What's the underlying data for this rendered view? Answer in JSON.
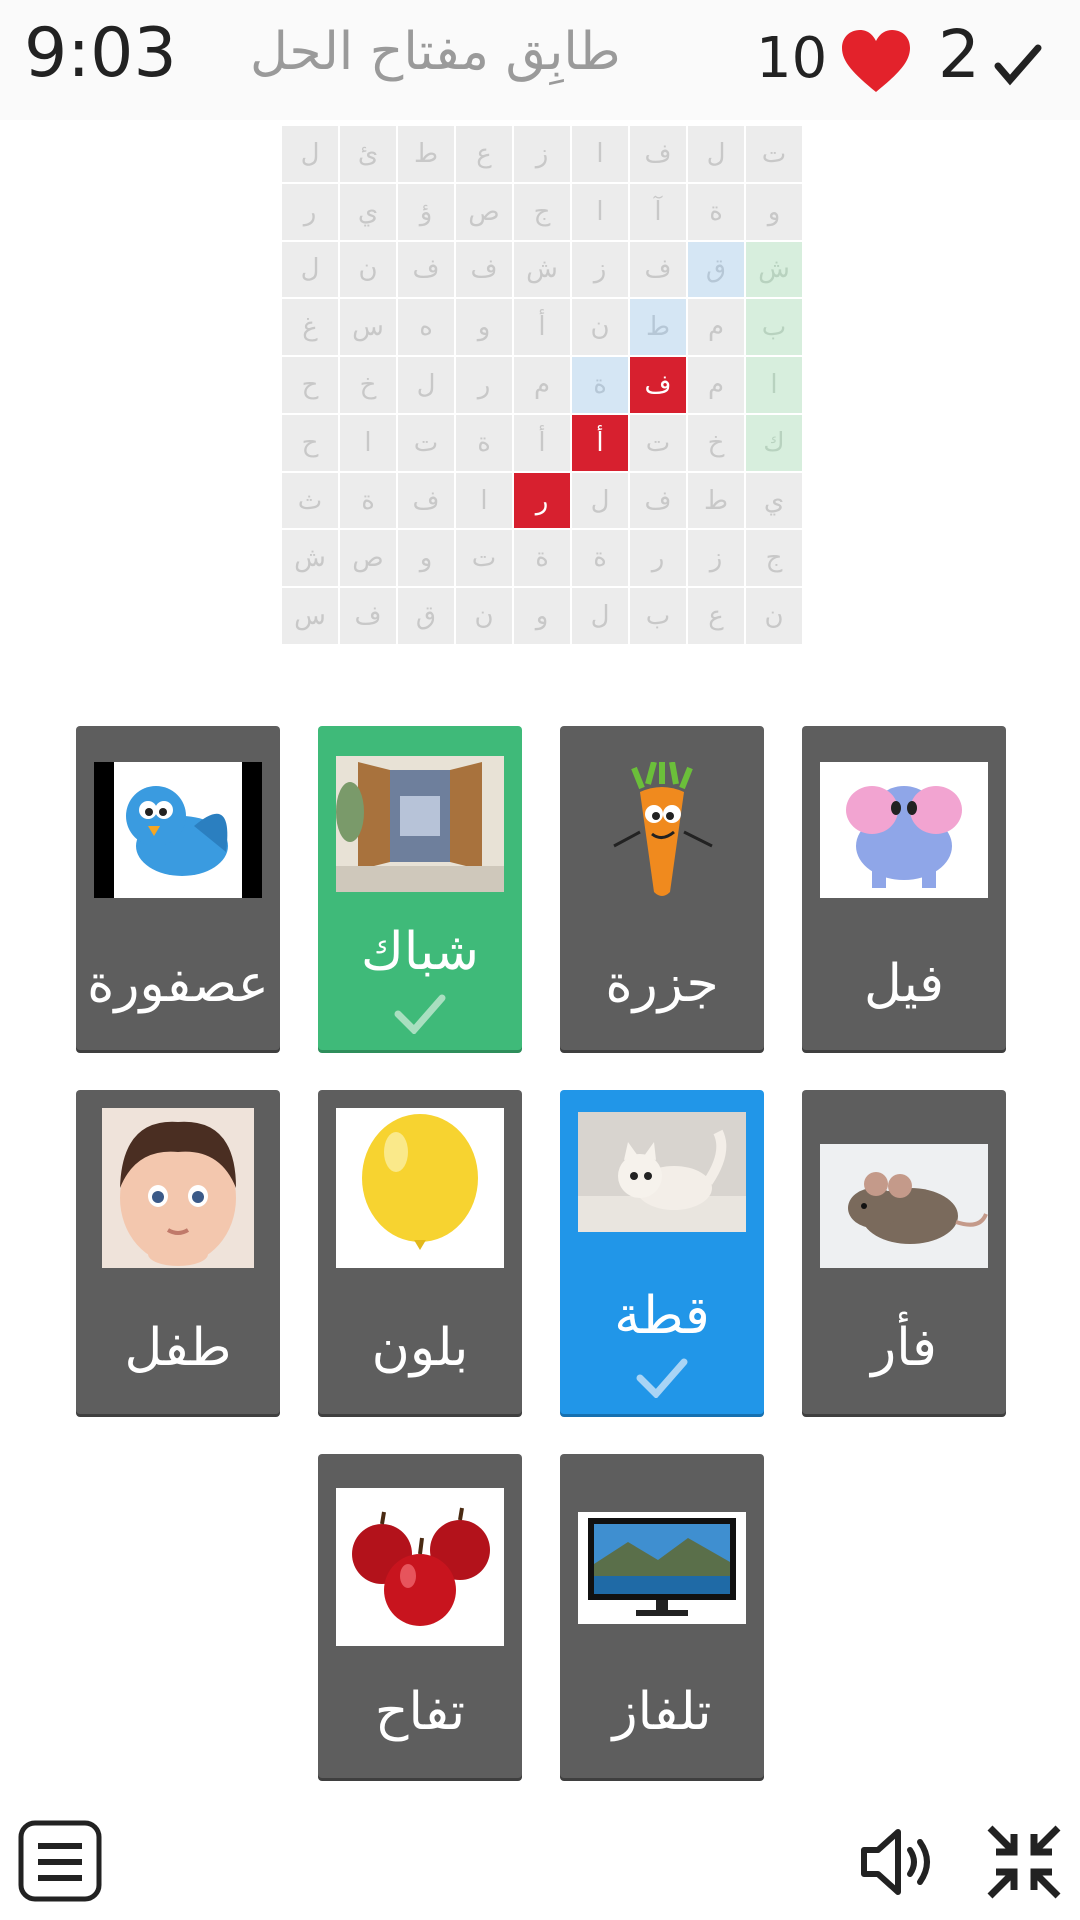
{
  "header": {
    "time": "9:03",
    "title": "طابِق مفتاح الحل",
    "lives": "10",
    "score": "2"
  },
  "grid": {
    "rows": [
      [
        "ل",
        "ئ",
        "ط",
        "ع",
        "ز",
        "ا",
        "ف",
        "ل",
        "ت"
      ],
      [
        "ر",
        "ي",
        "ؤ",
        "ص",
        "ج",
        "ا",
        "آ",
        "ة",
        "و"
      ],
      [
        "ل",
        "ن",
        "ف",
        "ف",
        "ش",
        "ز",
        "ف",
        "ق",
        "ش"
      ],
      [
        "غ",
        "س",
        "ه",
        "و",
        "أ",
        "ن",
        "ط",
        "م",
        "ب"
      ],
      [
        "ح",
        "خ",
        "ل",
        "ر",
        "م",
        "ة",
        "ف",
        "م",
        "ا"
      ],
      [
        "ح",
        "ا",
        "ت",
        "ة",
        "أ",
        "أ",
        "ت",
        "خ",
        "ك"
      ],
      [
        "ث",
        "ة",
        "ف",
        "ا",
        "ر",
        "ل",
        "ف",
        "ط",
        "ي"
      ],
      [
        "ش",
        "ص",
        "و",
        "ت",
        "ة",
        "ة",
        "ر",
        "ز",
        "ج"
      ],
      [
        "س",
        "ف",
        "ق",
        "ن",
        "و",
        "ل",
        "ب",
        "ع",
        "ن"
      ]
    ],
    "highlight": {
      "red": [
        "4-6",
        "5-5",
        "6-4"
      ],
      "blue": [
        "2-7",
        "3-6",
        "4-5"
      ],
      "green": [
        "2-8",
        "3-8",
        "4-8",
        "5-8"
      ]
    }
  },
  "cards": [
    {
      "word": "فيل",
      "image": "elephant-image",
      "state": "default"
    },
    {
      "word": "جزرة",
      "image": "carrot-image",
      "state": "default"
    },
    {
      "word": "شباك",
      "image": "window-image",
      "state": "correct"
    },
    {
      "word": "عصفورة",
      "image": "bird-image",
      "state": "default"
    },
    {
      "word": "فأر",
      "image": "mouse-image",
      "state": "default"
    },
    {
      "word": "قطة",
      "image": "cat-image",
      "state": "selected"
    },
    {
      "word": "بلون",
      "image": "balloon-image",
      "state": "default"
    },
    {
      "word": "طفل",
      "image": "baby-image",
      "state": "default"
    },
    {
      "word": "تلفاز",
      "image": "tv-image",
      "state": "default"
    },
    {
      "word": "تفاح",
      "image": "apples-image",
      "state": "default"
    }
  ],
  "colors": {
    "card_default": "#5e5e5e",
    "card_correct": "#3fba79",
    "card_selected": "#2196e8",
    "highlight_red": "#d7202f"
  },
  "icons": [
    "heart-icon",
    "check-icon",
    "menu-icon",
    "sound-icon",
    "collapse-icon"
  ]
}
